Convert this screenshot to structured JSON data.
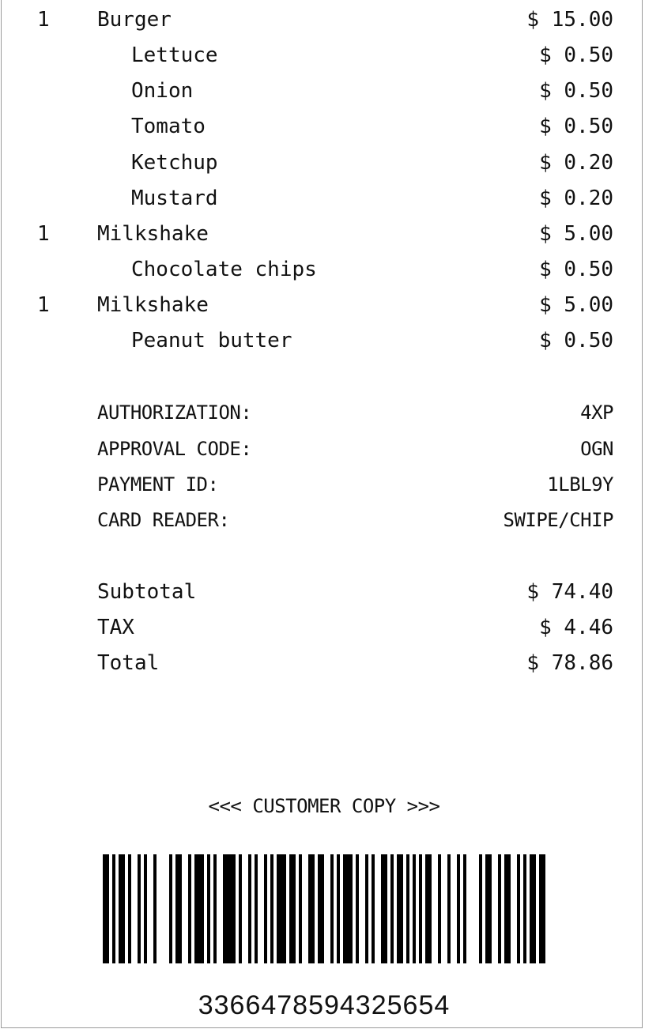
{
  "items": [
    {
      "qty": "1",
      "name": "Burger",
      "amount": "$ 15.00",
      "modifier": false
    },
    {
      "qty": "",
      "name": "Lettuce",
      "amount": "$ 0.50",
      "modifier": true
    },
    {
      "qty": "",
      "name": "Onion",
      "amount": "$ 0.50",
      "modifier": true
    },
    {
      "qty": "",
      "name": "Tomato",
      "amount": "$ 0.50",
      "modifier": true
    },
    {
      "qty": "",
      "name": "Ketchup",
      "amount": "$ 0.20",
      "modifier": true
    },
    {
      "qty": "",
      "name": "Mustard",
      "amount": "$ 0.20",
      "modifier": true
    },
    {
      "qty": "1",
      "name": "Milkshake",
      "amount": "$ 5.00",
      "modifier": false
    },
    {
      "qty": "",
      "name": "Chocolate chips",
      "amount": "$ 0.50",
      "modifier": true
    },
    {
      "qty": "1",
      "name": "Milkshake",
      "amount": "$ 5.00",
      "modifier": false
    },
    {
      "qty": "",
      "name": "Peanut butter",
      "amount": "$ 0.50",
      "modifier": true
    }
  ],
  "payment": {
    "authorization_label": "AUTHORIZATION:",
    "authorization_value": "4XP",
    "approval_label": "APPROVAL CODE:",
    "approval_value": "OGN",
    "payment_id_label": "PAYMENT ID:",
    "payment_id_value": "1LBL9Y",
    "card_reader_label": "CARD READER:",
    "card_reader_value": "SWIPE/CHIP"
  },
  "totals": {
    "subtotal_label": "Subtotal",
    "subtotal_value": "$ 74.40",
    "tax_label": "TAX",
    "tax_value": "$ 4.46",
    "total_label": "Total",
    "total_value": "$ 78.86"
  },
  "footer": {
    "copy_label": "<<< CUSTOMER COPY >>>",
    "barcode_number": "3366478594325654"
  }
}
